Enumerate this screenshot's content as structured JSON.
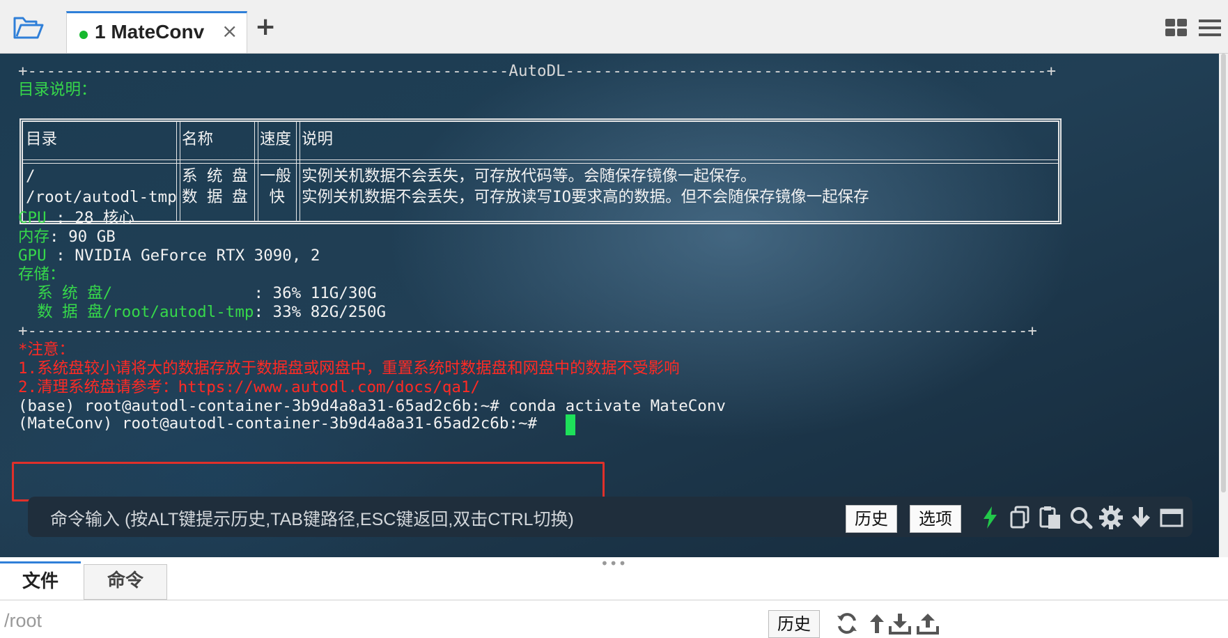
{
  "tab": {
    "number": "1",
    "title": "MateConv",
    "close": "×",
    "add": "+"
  },
  "term": {
    "rule_top": "+---------------------------------------------------AutoDL---------------------------------------------------+",
    "dir_label": "目录说明：",
    "table": {
      "headers": [
        "目录",
        "名称",
        "速度",
        "说明"
      ],
      "rows": [
        [
          "/",
          "系 统 盘",
          "一般",
          "实例关机数据不会丢失，可存放代码等。会随保存镜像一起保存。"
        ],
        [
          "/root/autodl-tmp",
          "数 据 盘",
          " 快 ",
          "实例关机数据不会丢失，可存放读写IO要求高的数据。但不会随保存镜像一起保存"
        ]
      ]
    },
    "cpu_label": "CPU",
    "cpu_value": " : 28 核心",
    "mem_label": "内存",
    "mem_value": ": 90 GB",
    "gpu_label": "GPU",
    "gpu_value": " : NVIDIA GeForce RTX 3090, 2",
    "storage_label": "存储：",
    "sys_disk_label": "  系 统 盘/               ",
    "sys_disk_value": ": 36% 11G/30G",
    "data_disk_label": "  数 据 盘/root/autodl-tmp",
    "data_disk_value": ": 33% 82G/250G",
    "rule_bottom": "+----------------------------------------------------------------------------------------------------------+",
    "note_title": "*注意：",
    "note_1": "1.系统盘较小请将大的数据存放于数据盘或网盘中，重置系统时数据盘和网盘中的数据不受影响",
    "note_2": "2.清理系统盘请参考：https://www.autodl.com/docs/qa1/",
    "line_base": "(base) root@autodl-container-3b9d4a8a31-65ad2c6b:~# conda activate MateConv",
    "line_prompt": "(MateConv) root@autodl-container-3b9d4a8a31-65ad2c6b:~# "
  },
  "cmd": {
    "placeholder": "命令输入 (按ALT键提示历史,TAB键路径,ESC键返回,双击CTRL切换)",
    "history": "历史",
    "options": "选项"
  },
  "icons": {
    "folder": "folder-open-icon",
    "layout": "grid-layout-icon",
    "menu": "hamburger-menu-icon",
    "lightning": "lightning-icon",
    "copy": "copy-icon",
    "paste": "paste-icon",
    "search": "search-icon",
    "settings": "gear-icon",
    "download": "arrow-down-icon",
    "window": "window-icon"
  },
  "bottom": {
    "tab_files": "文件",
    "tab_commands": "命令",
    "path": "/root",
    "history": "历史"
  },
  "colors": {
    "accent": "#2f7fd8",
    "status_green": "#16b82e",
    "terminal_green": "#36d84a",
    "terminal_red": "#ff2a24",
    "highlight": "#e0302a",
    "lightning": "#22c84a"
  }
}
